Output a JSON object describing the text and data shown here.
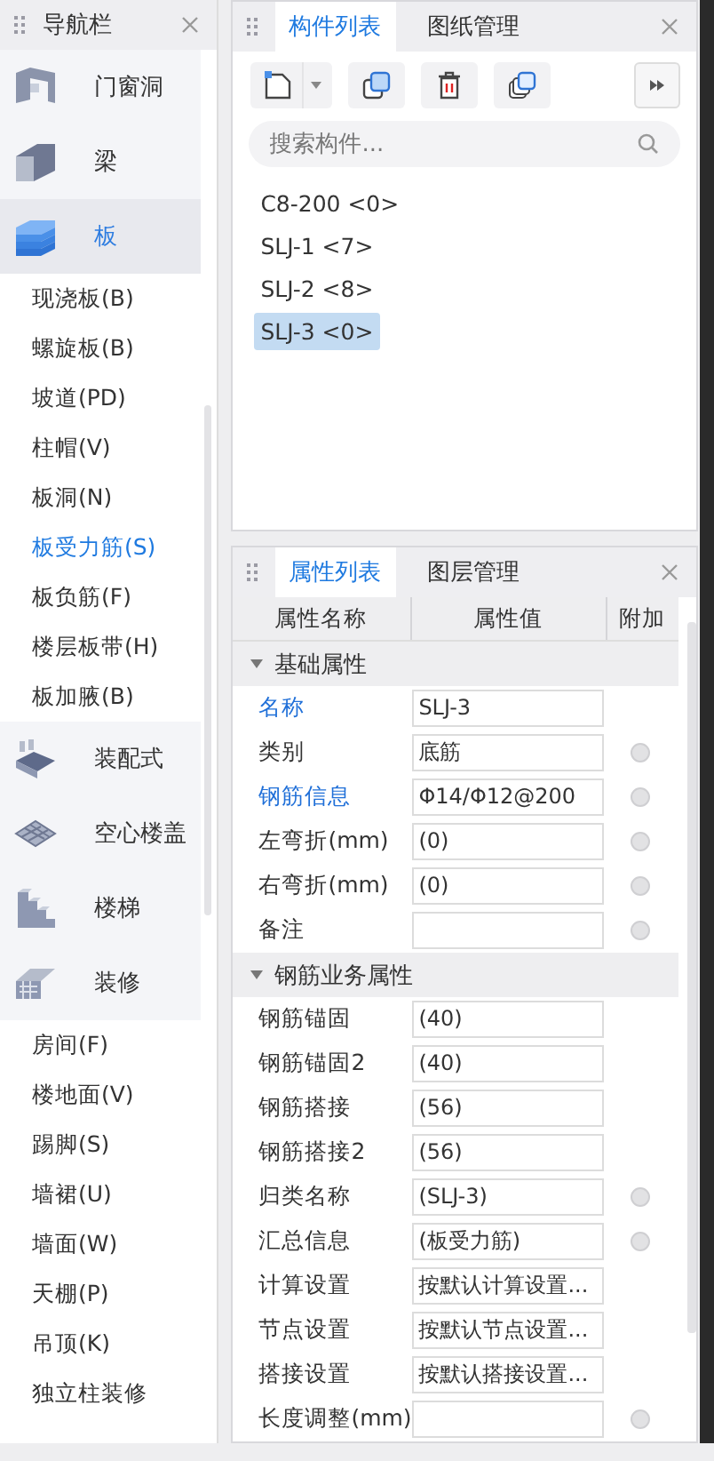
{
  "navigator": {
    "title": "导航栏",
    "categories": [
      {
        "label": "门窗洞",
        "selected": false
      },
      {
        "label": "梁",
        "selected": false
      },
      {
        "label": "板",
        "selected": true,
        "children": [
          {
            "label": "现浇板(B)",
            "selected": false
          },
          {
            "label": "螺旋板(B)",
            "selected": false
          },
          {
            "label": "坡道(PD)",
            "selected": false
          },
          {
            "label": "柱帽(V)",
            "selected": false
          },
          {
            "label": "板洞(N)",
            "selected": false
          },
          {
            "label": "板受力筋(S)",
            "selected": true
          },
          {
            "label": "板负筋(F)",
            "selected": false
          },
          {
            "label": "楼层板带(H)",
            "selected": false
          },
          {
            "label": "板加腋(B)",
            "selected": false
          }
        ]
      },
      {
        "label": "装配式",
        "selected": false
      },
      {
        "label": "空心楼盖",
        "selected": false
      },
      {
        "label": "楼梯",
        "selected": false
      },
      {
        "label": "装修",
        "selected": false,
        "children": [
          {
            "label": "房间(F)",
            "selected": false
          },
          {
            "label": "楼地面(V)",
            "selected": false
          },
          {
            "label": "踢脚(S)",
            "selected": false
          },
          {
            "label": "墙裙(U)",
            "selected": false
          },
          {
            "label": "墙面(W)",
            "selected": false
          },
          {
            "label": "天棚(P)",
            "selected": false
          },
          {
            "label": "吊顶(K)",
            "selected": false
          },
          {
            "label": "独立柱装修",
            "selected": false
          }
        ]
      }
    ]
  },
  "component_panel": {
    "tabs": [
      {
        "label": "构件列表",
        "selected": true
      },
      {
        "label": "图纸管理",
        "selected": false
      }
    ],
    "search": {
      "placeholder": "搜索构件..."
    },
    "items": [
      {
        "label": "C8-200 <0>",
        "selected": false
      },
      {
        "label": "SLJ-1 <7>",
        "selected": false
      },
      {
        "label": "SLJ-2 <8>",
        "selected": false
      },
      {
        "label": "SLJ-3 <0>",
        "selected": true
      }
    ]
  },
  "property_panel": {
    "tabs": [
      {
        "label": "属性列表",
        "selected": true
      },
      {
        "label": "图层管理",
        "selected": false
      }
    ],
    "columns": [
      "属性名称",
      "属性值",
      "附加"
    ],
    "groups": [
      {
        "title": "基础属性",
        "expanded": true,
        "rows": [
          {
            "name": "名称",
            "value": "SLJ-3",
            "highlighted": true,
            "addition_checkbox": false
          },
          {
            "name": "类别",
            "value": "底筋",
            "highlighted": false,
            "addition_checkbox": true
          },
          {
            "name": "钢筋信息",
            "value": "Φ14/Φ12@200",
            "highlighted": true,
            "addition_checkbox": true
          },
          {
            "name": "左弯折(mm)",
            "value": "(0)",
            "highlighted": false,
            "addition_checkbox": true
          },
          {
            "name": "右弯折(mm)",
            "value": "(0)",
            "highlighted": false,
            "addition_checkbox": true
          },
          {
            "name": "备注",
            "value": "",
            "highlighted": false,
            "addition_checkbox": true
          }
        ]
      },
      {
        "title": "钢筋业务属性",
        "expanded": true,
        "rows": [
          {
            "name": "钢筋锚固",
            "value": "(40)",
            "highlighted": false,
            "addition_checkbox": false
          },
          {
            "name": "钢筋锚固2",
            "value": "(40)",
            "highlighted": false,
            "addition_checkbox": false
          },
          {
            "name": "钢筋搭接",
            "value": "(56)",
            "highlighted": false,
            "addition_checkbox": false
          },
          {
            "name": "钢筋搭接2",
            "value": "(56)",
            "highlighted": false,
            "addition_checkbox": false
          },
          {
            "name": "归类名称",
            "value": "(SLJ-3)",
            "highlighted": false,
            "addition_checkbox": true
          },
          {
            "name": "汇总信息",
            "value": "(板受力筋)",
            "highlighted": false,
            "addition_checkbox": true
          },
          {
            "name": "计算设置",
            "value": "按默认计算设置...",
            "highlighted": false,
            "addition_checkbox": false
          },
          {
            "name": "节点设置",
            "value": "按默认节点设置...",
            "highlighted": false,
            "addition_checkbox": false
          },
          {
            "name": "搭接设置",
            "value": "按默认搭接设置...",
            "highlighted": false,
            "addition_checkbox": false
          },
          {
            "name": "长度调整(mm)",
            "value": "",
            "highlighted": false,
            "addition_checkbox": true
          }
        ]
      }
    ]
  }
}
